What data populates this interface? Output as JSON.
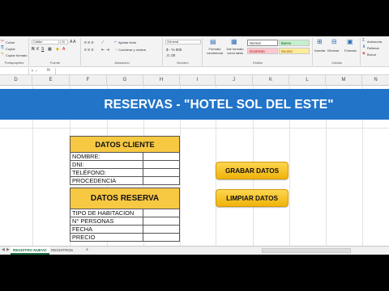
{
  "ribbon": {
    "clipboard": {
      "cut": "Cortar",
      "copy": "Copiar",
      "format_painter": "Copiar formato",
      "label": "Portapapeles"
    },
    "font": {
      "name": "Calibri",
      "size": "11",
      "label": "Fuente"
    },
    "alignment": {
      "wrap": "Ajustar texto",
      "merge": "Combinar y centrar",
      "label": "Alineación"
    },
    "number": {
      "format": "General",
      "label": "Número"
    },
    "styles": {
      "conditional": "Formato condicional",
      "as_table": "Dar formato como tabla",
      "normal": "Normal",
      "bueno": "Bueno",
      "incorrecto": "Incorrecto",
      "neutral": "Neutral",
      "label": "Estilos"
    },
    "cells": {
      "insert": "Insertar",
      "delete": "Eliminar",
      "format": "Formato",
      "label": "Celdas"
    },
    "editing": {
      "autosum": "Autosuma",
      "fill": "Rellenar",
      "clear": "Borrar"
    },
    "colors": {
      "normal": "#ffffff",
      "bueno_bg": "#c6efce",
      "bueno_fg": "#006100",
      "incorrecto_bg": "#ffc7ce",
      "incorrecto_fg": "#9c0006",
      "neutral_bg": "#ffeb9c",
      "neutral_fg": "#9c5700"
    }
  },
  "formula_bar": {
    "fx": "fx",
    "value": ""
  },
  "columns": [
    "D",
    "E",
    "F",
    "G",
    "H",
    "I",
    "J",
    "K",
    "L",
    "M",
    "N"
  ],
  "banner": {
    "title": "RESERVAS - \"HOTEL SOL DEL ESTE\"",
    "color": "#2174c8"
  },
  "cliente": {
    "header": "DATOS CLIENTE",
    "fields": [
      "NOMBRE:",
      "DNI:",
      "TELÉFONO:",
      "PROCEDENCIA"
    ]
  },
  "reserva": {
    "header": "DATOS RESERVA",
    "fields": [
      "TIPO DE HABITACION",
      "N° PERSONAS",
      "FECHA",
      "PRECIO"
    ]
  },
  "buttons": {
    "save": "GRABAR DATOS",
    "clear": "LIMPIAR DATOS",
    "color": "#f7c842"
  },
  "sheets": {
    "active": "REGISTRO NUEVO",
    "other": "REGISTROS",
    "add": "+"
  }
}
